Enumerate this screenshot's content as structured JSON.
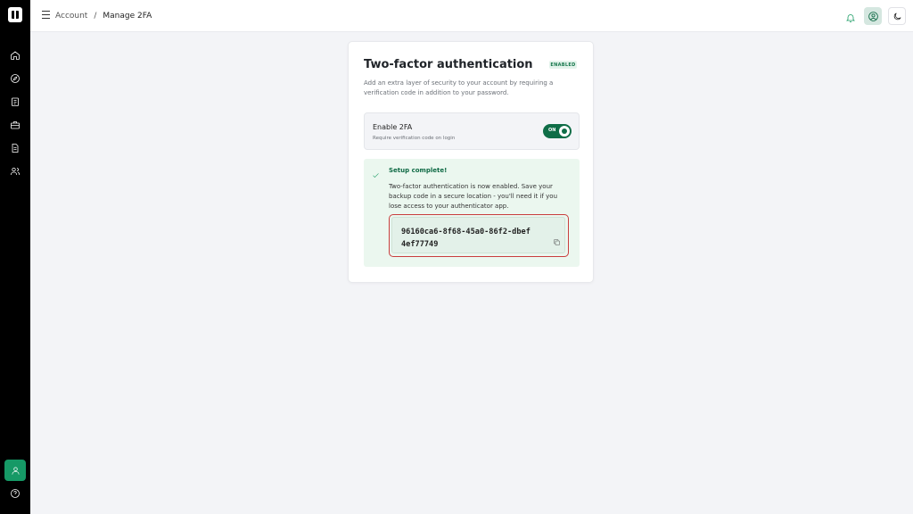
{
  "breadcrumb": {
    "account": "Account",
    "separator": "/",
    "current": "Manage 2FA"
  },
  "icons": {
    "sidebar": [
      "home-icon",
      "compass-icon",
      "clipboard-icon",
      "briefcase-icon",
      "document-icon",
      "users-icon"
    ],
    "sidebar_bottom": [
      "user-icon",
      "help-icon"
    ],
    "topbar": [
      "menu-icon",
      "bell-icon",
      "profile-icon",
      "moon-icon"
    ],
    "success": "check-icon",
    "copy": "copy-icon"
  },
  "colors": {
    "accent": "#169966",
    "toggle": "#0f6d47",
    "success_bg": "#ebf7ef",
    "highlight_border": "#c93e3e"
  },
  "card": {
    "title": "Two-factor authentication",
    "badge": "ENABLED",
    "description": "Add an extra layer of security to your account by requiring a verification code in addition to your password.",
    "toggle": {
      "title": "Enable 2FA",
      "subtitle": "Require verification code on login",
      "state": "ON"
    },
    "success": {
      "title": "Setup complete!",
      "message": "Two-factor authentication is now enabled. Save your backup code in a secure location - you'll need it if you lose access to your authenticator app.",
      "backup_code": "96160ca6-8f68-45a0-86f2-dbef4ef77749"
    }
  }
}
